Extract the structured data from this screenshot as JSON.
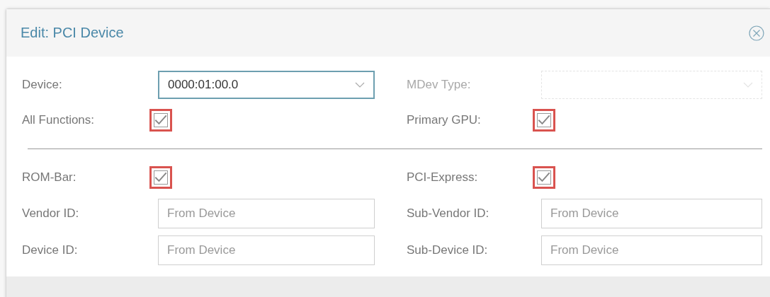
{
  "dialog": {
    "title": "Edit: PCI Device"
  },
  "general": [
    {
      "kind": "combo",
      "label": "Device:",
      "value": "0000:01:00.0",
      "disabled": false,
      "focused": true
    },
    {
      "kind": "combo",
      "label": "MDev Type:",
      "disabled": true,
      "focused": false
    },
    {
      "kind": "checkbox",
      "label": "All Functions:",
      "checked": true,
      "highlighted": true
    },
    {
      "kind": "checkbox",
      "label": "Primary GPU:",
      "checked": true,
      "highlighted": true
    }
  ],
  "advanced": [
    {
      "kind": "checkbox",
      "label": "ROM-Bar:",
      "checked": true,
      "highlighted": true
    },
    {
      "kind": "checkbox",
      "label": "PCI-Express:",
      "checked": true,
      "highlighted": true
    },
    {
      "kind": "text",
      "label": "Vendor ID:",
      "placeholder": "From Device"
    },
    {
      "kind": "text",
      "label": "Sub-Vendor ID:",
      "placeholder": "From Device"
    },
    {
      "kind": "text",
      "label": "Device ID:",
      "placeholder": "From Device"
    },
    {
      "kind": "text",
      "label": "Sub-Device ID:",
      "placeholder": "From Device"
    }
  ]
}
